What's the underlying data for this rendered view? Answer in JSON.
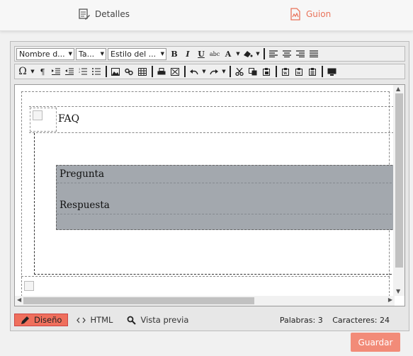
{
  "tabs": {
    "detalles": "Detalles",
    "guion": "Guion",
    "active_color": "#e9735a"
  },
  "toolbar": {
    "font_name": "Nombre d...",
    "font_size": "Ta...",
    "style": "Estilo del ...",
    "bold": "B",
    "italic": "I",
    "underline": "U",
    "strikethrough": "abc",
    "font_color": "A",
    "omega": "Ω",
    "paragraph": "¶"
  },
  "document": {
    "title": "FAQ",
    "question": "Pregunta",
    "answer": "Respuesta",
    "qa_background": "#a3a8ae"
  },
  "modes": {
    "design": "Diseño",
    "html": "HTML",
    "preview": "Vista previa"
  },
  "stats": {
    "words": "Palabras: 3",
    "chars": "Caracteres: 24"
  },
  "actions": {
    "save": "Guardar",
    "save_color": "#f28b78"
  }
}
